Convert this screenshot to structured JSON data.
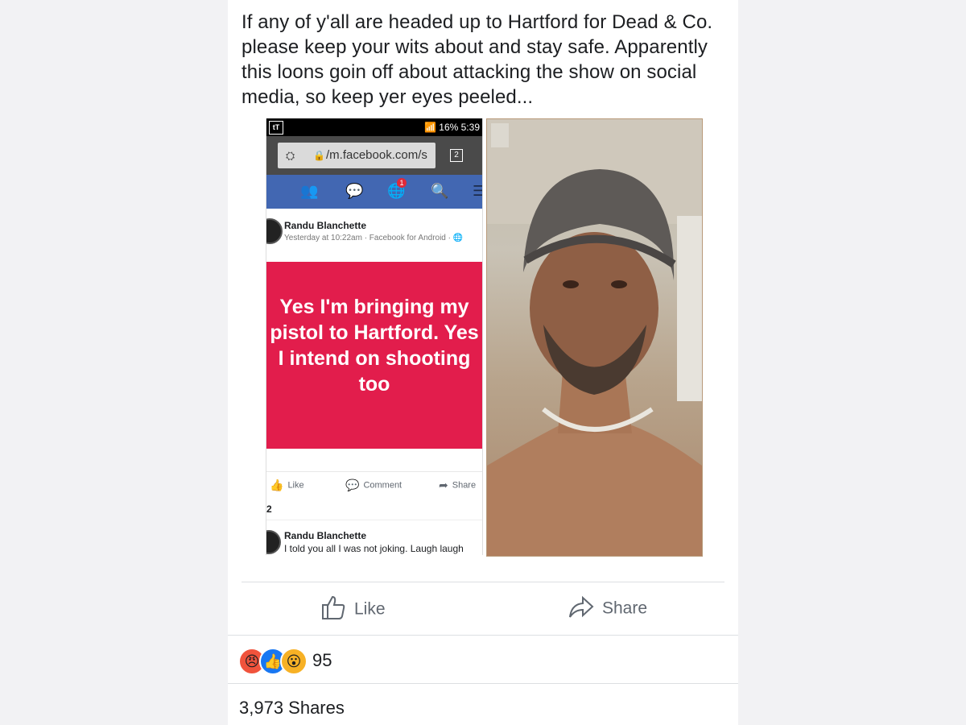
{
  "post": {
    "text": "If any of y'all are headed up to Hartford for Dead & Co. please keep your wits about and stay safe. Apparently this loons goin off about attacking the show on social media, so keep yer eyes peeled..."
  },
  "embedded_screenshot": {
    "status_bar": {
      "app_icon": "tT",
      "right": "16% 5:39"
    },
    "url": "/m.facebook.com/s",
    "tab_count": "2",
    "notification_badge": "1",
    "nav_icons": [
      "friends-icon",
      "messenger-icon",
      "globe-icon",
      "search-icon",
      "menu-icon"
    ],
    "poster_name": "Randu Blanchette",
    "poster_meta": "Yesterday at 10:22am · Facebook for Android · 🌐",
    "red_post_text": "Yes I'm bringing my pistol to Hartford. Yes I intend on shooting too",
    "actions": {
      "like": "Like",
      "comment": "Comment",
      "share": "Share"
    },
    "count": "2",
    "comment": {
      "name": "Randu Blanchette",
      "text": "I told you all I was not joking. Laugh laugh"
    },
    "colors": {
      "red_panel": "#e21d4c",
      "fb_blue": "#4267b2"
    }
  },
  "actions": {
    "like": "Like",
    "share": "Share"
  },
  "reactions": {
    "icons": [
      "angry-reaction-icon",
      "like-reaction-icon",
      "wow-reaction-icon"
    ],
    "count": "95"
  },
  "shares": "3,973 Shares"
}
